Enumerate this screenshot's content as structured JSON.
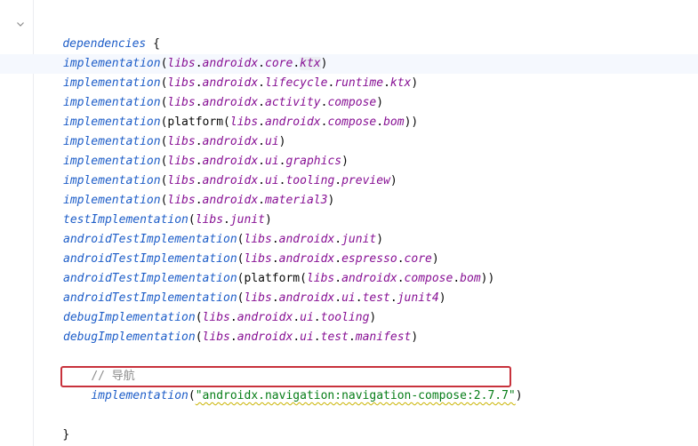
{
  "block": {
    "keyword": "dependencies",
    "open_brace": "{",
    "close_brace": "}"
  },
  "lines": [
    {
      "fn": "implementation",
      "open": "(",
      "segments": [
        {
          "t": "prop",
          "v": "libs"
        },
        {
          "t": "punct",
          "v": "."
        },
        {
          "t": "prop",
          "v": "androidx"
        },
        {
          "t": "punct",
          "v": "."
        },
        {
          "t": "prop",
          "v": "core"
        },
        {
          "t": "punct",
          "v": "."
        },
        {
          "t": "prop",
          "v": "ktx",
          "hl": true
        }
      ],
      "close": ")"
    },
    {
      "fn": "implementation",
      "open": "(",
      "segments": [
        {
          "t": "prop",
          "v": "libs"
        },
        {
          "t": "punct",
          "v": "."
        },
        {
          "t": "prop",
          "v": "androidx"
        },
        {
          "t": "punct",
          "v": "."
        },
        {
          "t": "prop",
          "v": "lifecycle"
        },
        {
          "t": "punct",
          "v": "."
        },
        {
          "t": "prop",
          "v": "runtime"
        },
        {
          "t": "punct",
          "v": "."
        },
        {
          "t": "prop",
          "v": "ktx"
        }
      ],
      "close": ")"
    },
    {
      "fn": "implementation",
      "open": "(",
      "segments": [
        {
          "t": "prop",
          "v": "libs"
        },
        {
          "t": "punct",
          "v": "."
        },
        {
          "t": "prop",
          "v": "androidx"
        },
        {
          "t": "punct",
          "v": "."
        },
        {
          "t": "prop",
          "v": "activity"
        },
        {
          "t": "punct",
          "v": "."
        },
        {
          "t": "prop",
          "v": "compose"
        }
      ],
      "close": ")"
    },
    {
      "fn": "implementation",
      "open": "(",
      "segments": [
        {
          "t": "plain",
          "v": "platform("
        },
        {
          "t": "prop",
          "v": "libs"
        },
        {
          "t": "punct",
          "v": "."
        },
        {
          "t": "prop",
          "v": "androidx"
        },
        {
          "t": "punct",
          "v": "."
        },
        {
          "t": "prop",
          "v": "compose"
        },
        {
          "t": "punct",
          "v": "."
        },
        {
          "t": "prop",
          "v": "bom"
        },
        {
          "t": "plain",
          "v": ")"
        }
      ],
      "close": ")"
    },
    {
      "fn": "implementation",
      "open": "(",
      "segments": [
        {
          "t": "prop",
          "v": "libs"
        },
        {
          "t": "punct",
          "v": "."
        },
        {
          "t": "prop",
          "v": "androidx"
        },
        {
          "t": "punct",
          "v": "."
        },
        {
          "t": "prop",
          "v": "ui"
        }
      ],
      "close": ")"
    },
    {
      "fn": "implementation",
      "open": "(",
      "segments": [
        {
          "t": "prop",
          "v": "libs"
        },
        {
          "t": "punct",
          "v": "."
        },
        {
          "t": "prop",
          "v": "androidx"
        },
        {
          "t": "punct",
          "v": "."
        },
        {
          "t": "prop",
          "v": "ui"
        },
        {
          "t": "punct",
          "v": "."
        },
        {
          "t": "prop",
          "v": "graphics"
        }
      ],
      "close": ")"
    },
    {
      "fn": "implementation",
      "open": "(",
      "segments": [
        {
          "t": "prop",
          "v": "libs"
        },
        {
          "t": "punct",
          "v": "."
        },
        {
          "t": "prop",
          "v": "androidx"
        },
        {
          "t": "punct",
          "v": "."
        },
        {
          "t": "prop",
          "v": "ui"
        },
        {
          "t": "punct",
          "v": "."
        },
        {
          "t": "prop",
          "v": "tooling"
        },
        {
          "t": "punct",
          "v": "."
        },
        {
          "t": "prop",
          "v": "preview"
        }
      ],
      "close": ")"
    },
    {
      "fn": "implementation",
      "open": "(",
      "segments": [
        {
          "t": "prop",
          "v": "libs"
        },
        {
          "t": "punct",
          "v": "."
        },
        {
          "t": "prop",
          "v": "androidx"
        },
        {
          "t": "punct",
          "v": "."
        },
        {
          "t": "prop",
          "v": "material3"
        }
      ],
      "close": ")"
    },
    {
      "fn": "testImplementation",
      "open": "(",
      "segments": [
        {
          "t": "prop",
          "v": "libs"
        },
        {
          "t": "punct",
          "v": "."
        },
        {
          "t": "prop",
          "v": "junit"
        }
      ],
      "close": ")"
    },
    {
      "fn": "androidTestImplementation",
      "open": "(",
      "segments": [
        {
          "t": "prop",
          "v": "libs"
        },
        {
          "t": "punct",
          "v": "."
        },
        {
          "t": "prop",
          "v": "androidx"
        },
        {
          "t": "punct",
          "v": "."
        },
        {
          "t": "prop",
          "v": "junit"
        }
      ],
      "close": ")"
    },
    {
      "fn": "androidTestImplementation",
      "open": "(",
      "segments": [
        {
          "t": "prop",
          "v": "libs"
        },
        {
          "t": "punct",
          "v": "."
        },
        {
          "t": "prop",
          "v": "androidx"
        },
        {
          "t": "punct",
          "v": "."
        },
        {
          "t": "prop",
          "v": "espresso"
        },
        {
          "t": "punct",
          "v": "."
        },
        {
          "t": "prop",
          "v": "core"
        }
      ],
      "close": ")"
    },
    {
      "fn": "androidTestImplementation",
      "open": "(",
      "segments": [
        {
          "t": "plain",
          "v": "platform("
        },
        {
          "t": "prop",
          "v": "libs"
        },
        {
          "t": "punct",
          "v": "."
        },
        {
          "t": "prop",
          "v": "androidx"
        },
        {
          "t": "punct",
          "v": "."
        },
        {
          "t": "prop",
          "v": "compose"
        },
        {
          "t": "punct",
          "v": "."
        },
        {
          "t": "prop",
          "v": "bom"
        },
        {
          "t": "plain",
          "v": ")"
        }
      ],
      "close": ")"
    },
    {
      "fn": "androidTestImplementation",
      "open": "(",
      "segments": [
        {
          "t": "prop",
          "v": "libs"
        },
        {
          "t": "punct",
          "v": "."
        },
        {
          "t": "prop",
          "v": "androidx"
        },
        {
          "t": "punct",
          "v": "."
        },
        {
          "t": "prop",
          "v": "ui"
        },
        {
          "t": "punct",
          "v": "."
        },
        {
          "t": "prop",
          "v": "test"
        },
        {
          "t": "punct",
          "v": "."
        },
        {
          "t": "prop",
          "v": "junit4"
        }
      ],
      "close": ")"
    },
    {
      "fn": "debugImplementation",
      "open": "(",
      "segments": [
        {
          "t": "prop",
          "v": "libs"
        },
        {
          "t": "punct",
          "v": "."
        },
        {
          "t": "prop",
          "v": "androidx"
        },
        {
          "t": "punct",
          "v": "."
        },
        {
          "t": "prop",
          "v": "ui"
        },
        {
          "t": "punct",
          "v": "."
        },
        {
          "t": "prop",
          "v": "tooling"
        }
      ],
      "close": ")"
    },
    {
      "fn": "debugImplementation",
      "open": "(",
      "segments": [
        {
          "t": "prop",
          "v": "libs"
        },
        {
          "t": "punct",
          "v": "."
        },
        {
          "t": "prop",
          "v": "androidx"
        },
        {
          "t": "punct",
          "v": "."
        },
        {
          "t": "prop",
          "v": "ui"
        },
        {
          "t": "punct",
          "v": "."
        },
        {
          "t": "prop",
          "v": "test"
        },
        {
          "t": "punct",
          "v": "."
        },
        {
          "t": "prop",
          "v": "manifest"
        }
      ],
      "close": ")"
    }
  ],
  "comment": "// 导航",
  "highlighted_line": {
    "fn": "implementation",
    "open": "(",
    "string": "\"androidx.navigation:navigation-compose:2.7.7\"",
    "close": ")"
  },
  "colors": {
    "function": "#1d5dc8",
    "property": "#871094",
    "string": "#067d17",
    "comment": "#8c8c8c",
    "highlight_border": "#c8323c"
  },
  "icons": {
    "fold": "chevron-down-icon"
  }
}
